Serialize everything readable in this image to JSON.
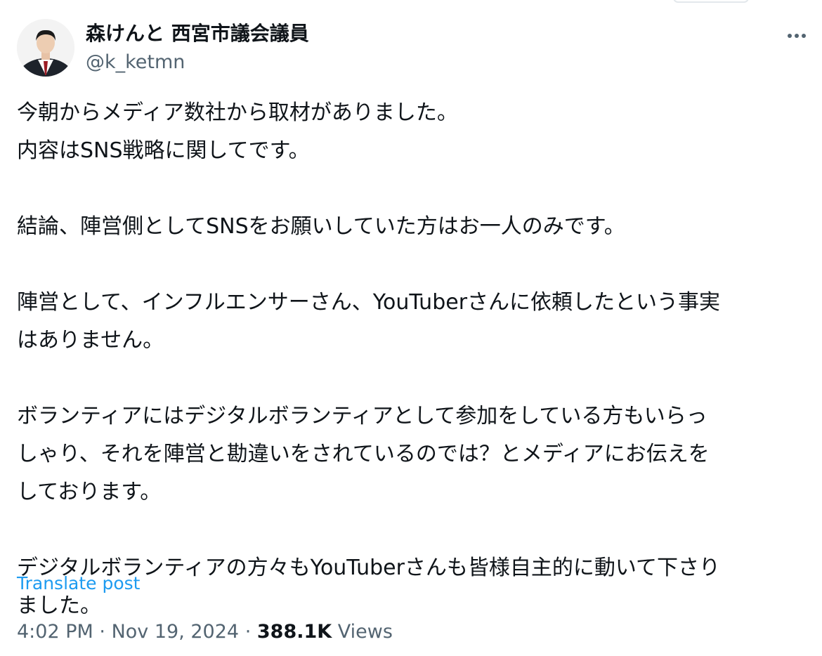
{
  "author": {
    "display_name": "森けんと 西宮市議会議員",
    "handle": "@k_ketmn"
  },
  "post": {
    "paragraphs": [
      "今朝からメディア数社から取材がありました。\n内容はSNS戦略に関してです。",
      "結論、陣営側としてSNSをお願いしていた方はお一人のみです。",
      "陣営として、インフルエンサーさん、YouTuberさんに依頼したという事実\nはありません。",
      "ボランティアにはデジタルボランティアとして参加をしている方もいらっ\nしゃり、それを陣営と勘違いをされているのでは？とメディアにお伝えを\nしております。",
      "デジタルボランティアの方々もYouTuberさんも皆様自主的に動いて下さり\nました。"
    ],
    "translate_label": "Translate post"
  },
  "meta": {
    "time": "4:02 PM",
    "separator": "·",
    "date": "Nov 19, 2024",
    "views_count": "388.1K",
    "views_label": "Views"
  },
  "icons": {
    "more": "more-horizontal-icon"
  },
  "colors": {
    "text": "#0f1419",
    "secondary": "#536471",
    "link": "#1d9bf0"
  }
}
